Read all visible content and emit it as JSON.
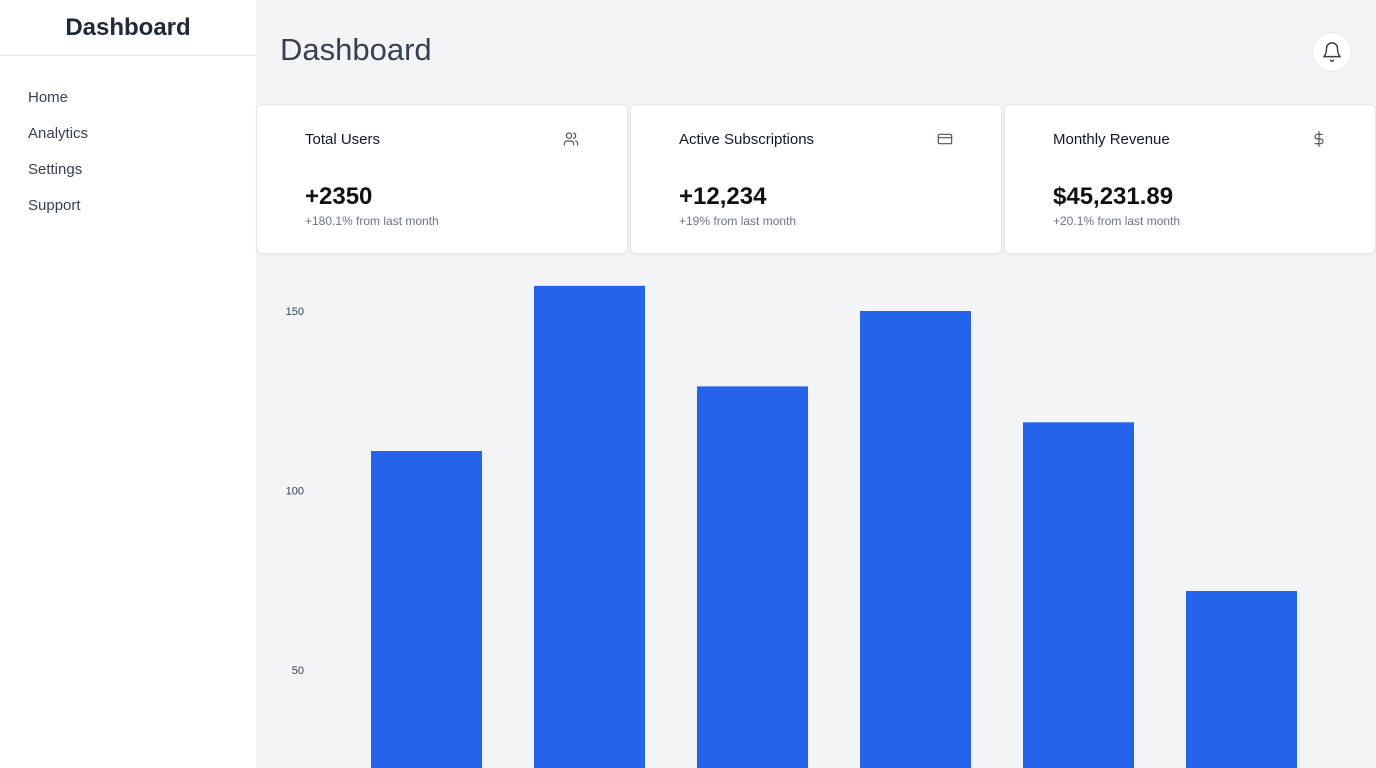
{
  "sidebar": {
    "brand": "Dashboard",
    "items": [
      {
        "label": "Home"
      },
      {
        "label": "Analytics"
      },
      {
        "label": "Settings"
      },
      {
        "label": "Support"
      }
    ]
  },
  "header": {
    "title": "Dashboard",
    "notification_icon": "bell-icon"
  },
  "cards": [
    {
      "title": "Total Users",
      "icon": "users-icon",
      "value": "+2350",
      "sub": "+180.1% from last month"
    },
    {
      "title": "Active Subscriptions",
      "icon": "credit-card-icon",
      "value": "+12,234",
      "sub": "+19% from last month"
    },
    {
      "title": "Monthly Revenue",
      "icon": "dollar-icon",
      "value": "$45,231.89",
      "sub": "+20.1% from last month"
    }
  ],
  "colors": {
    "bar": "#2563eb",
    "background": "#f3f4f6",
    "card": "#ffffff"
  },
  "chart_data": {
    "type": "bar",
    "categories": [
      "",
      "",
      "",
      "",
      "",
      ""
    ],
    "values": [
      111,
      157,
      129,
      150,
      119,
      72
    ],
    "title": "",
    "xlabel": "",
    "ylabel": "",
    "yticks": [
      150,
      100,
      50
    ],
    "ylim": [
      0,
      160
    ],
    "grid": false,
    "color": "#2563eb"
  }
}
